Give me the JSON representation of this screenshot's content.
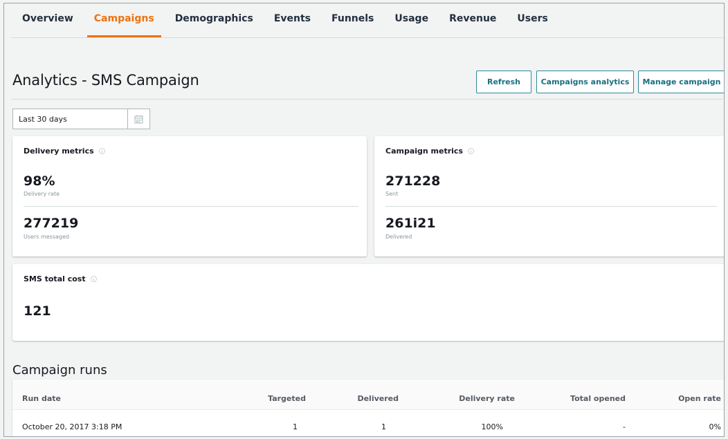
{
  "tabs": [
    "Overview",
    "Campaigns",
    "Demographics",
    "Events",
    "Funnels",
    "Usage",
    "Revenue",
    "Users"
  ],
  "active_tab": "Campaigns",
  "header": {
    "title": "Analytics - SMS Campaign",
    "buttons": {
      "refresh": "Refresh",
      "campaigns_analytics": "Campaigns analytics",
      "manage_campaign": "Manage campaign"
    }
  },
  "date_range": {
    "value": "Last 30 days"
  },
  "delivery_metrics": {
    "title": "Delivery metrics",
    "delivery_rate": {
      "value": "98%",
      "label": "Delivery rate"
    },
    "users_messaged": {
      "value": "277219",
      "label": "Users messaged"
    }
  },
  "campaign_metrics": {
    "title": "Campaign metrics",
    "sent": {
      "value": "271228",
      "label": "Sent"
    },
    "delivered": {
      "value": "261i21",
      "label": "Delivered"
    }
  },
  "sms_cost": {
    "title": "SMS total cost",
    "value": "121"
  },
  "campaign_runs": {
    "title": "Campaign runs",
    "columns": {
      "run_date": "Run date",
      "targeted": "Targeted",
      "delivered": "Delivered",
      "delivery_rate": "Delivery rate",
      "total_opened": "Total opened",
      "open_rate": "Open rate"
    },
    "rows": [
      {
        "run_date": "October 20, 2017 3:18 PM",
        "targeted": "1",
        "delivered": "1",
        "delivery_rate": "100%",
        "total_opened": "-",
        "open_rate": "0%"
      }
    ]
  },
  "colors": {
    "accent": "#ec7211",
    "button_border": "#2b8a9c",
    "button_text": "#1a6f80",
    "background": "#f2f3f3"
  }
}
